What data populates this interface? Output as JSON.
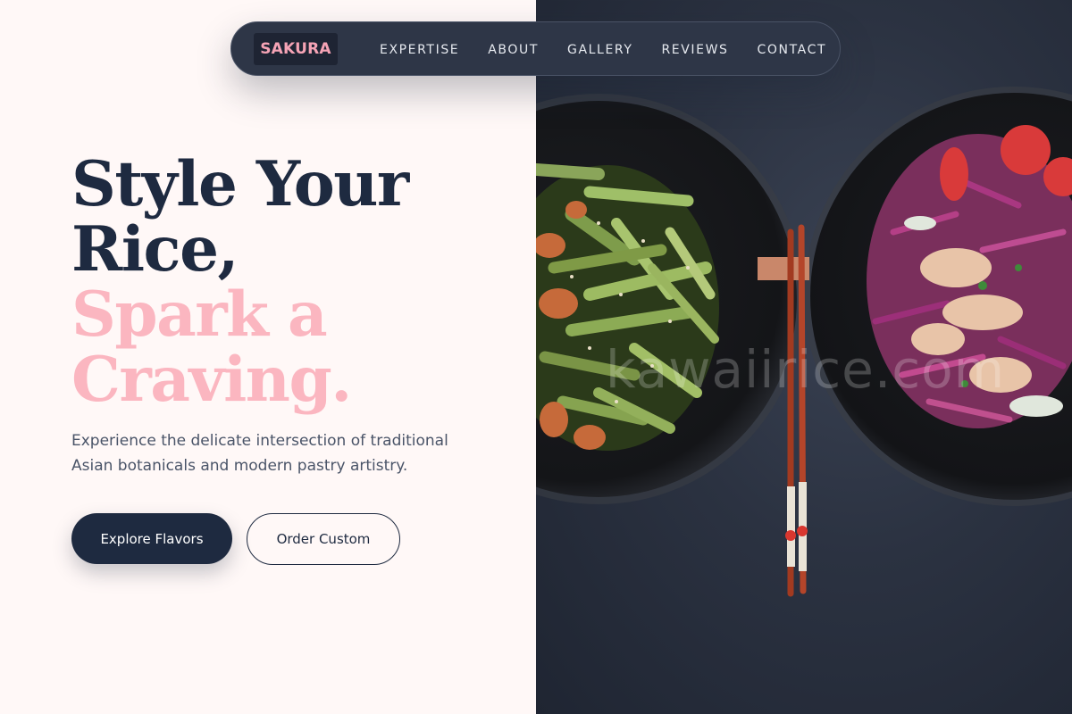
{
  "brand": {
    "logo_text": "SAKURA"
  },
  "nav": {
    "links": [
      {
        "label": "EXPERTISE"
      },
      {
        "label": "ABOUT"
      },
      {
        "label": "GALLERY"
      },
      {
        "label": "REVIEWS"
      },
      {
        "label": "CONTACT"
      }
    ]
  },
  "hero": {
    "headline_line1": "Style Your",
    "headline_line2": "Rice,",
    "headline_line3": "Spark a",
    "headline_line4": "Craving.",
    "subtext": "Experience the delicate intersection of traditional Asian botanicals and modern pastry artistry.",
    "primary_cta": "Explore Flavors",
    "secondary_cta": "Order Custom"
  },
  "image": {
    "watermark": "kawaiirice.com"
  },
  "colors": {
    "navy": "#1e2a40",
    "pink": "#fbb6c0",
    "background": "#fff8f7"
  }
}
